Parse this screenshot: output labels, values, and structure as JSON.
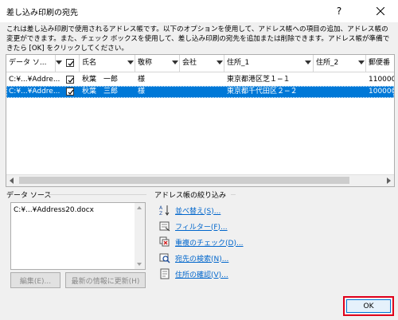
{
  "window": {
    "title": "差し込み印刷の宛先"
  },
  "description": "これは差し込み印刷で使用されるアドレス帳です。以下のオプションを使用して、アドレス帳への項目の追加、アドレス帳の変更ができます。また、チェック ボックスを使用して、差し込み印刷の宛先を追加または削除できます。アドレス帳が準備できたら [OK] をクリックしてください。",
  "table": {
    "columns": [
      "データ ソ...",
      "氏名",
      "敬称",
      "会社",
      "住所_1",
      "住所_2",
      "郵便番"
    ],
    "rows": [
      {
        "source": "C:¥...¥Addre...",
        "checked": true,
        "name": "秋葉　一郎",
        "honorific": "様",
        "company": "",
        "address1": "東京都港区芝１−１",
        "address2": "",
        "zip": "110000",
        "selected": false
      },
      {
        "source": "C:¥...¥Addre...",
        "checked": true,
        "name": "秋葉　三郎",
        "honorific": "様",
        "company": "",
        "address1": "東京都千代田区２−２",
        "address2": "",
        "zip": "100000",
        "selected": true
      }
    ]
  },
  "datasource": {
    "label": "データ ソース",
    "items": [
      "C:¥...¥Address20.docx"
    ],
    "edit_button": "編集(E)...",
    "refresh_button": "最新の情報に更新(H)"
  },
  "refine": {
    "label": "アドレス帳の絞り込み",
    "links": [
      "並べ替え(S)...",
      "フィルター(F)...",
      "重複のチェック(D)...",
      "宛先の検索(N)...",
      "住所の確認(V)..."
    ]
  },
  "ok_button": "OK",
  "colors": {
    "selection": "#0078d7",
    "link": "#0066cc",
    "highlight_frame": "#e0001b"
  }
}
